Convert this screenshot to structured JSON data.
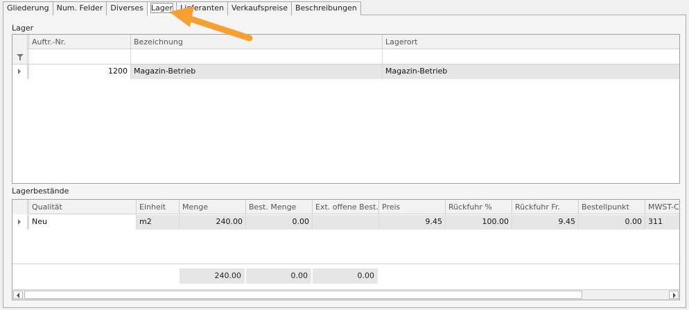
{
  "tabs": [
    "Gliederung",
    "Num. Felder",
    "Diverses",
    "Lager",
    "Lieferanten",
    "Verkaufspreise",
    "Beschreibungen"
  ],
  "active_tab": "Lager",
  "lager": {
    "title": "Lager",
    "columns": [
      "Auftr.-Nr.",
      "Bezeichnung",
      "Lagerort"
    ],
    "rows": [
      {
        "nr": "1200",
        "bezeichnung": "Magazin-Betrieb",
        "lagerort": "Magazin-Betrieb"
      }
    ]
  },
  "bestaende": {
    "title": "Lagerbestände",
    "columns": [
      "Qualität",
      "Einheit",
      "Menge",
      "Best. Menge",
      "Ext. offene Best...",
      "Preis",
      "Rückfuhr %",
      "Rückfuhr Fr.",
      "Bestellpunkt",
      "MWST-Co"
    ],
    "rows": [
      {
        "qualitaet": "Neu",
        "einheit": "m2",
        "menge": "240.00",
        "best_menge": "0.00",
        "ext_offene": "",
        "preis": "9.45",
        "rueckfuhr_pct": "100.00",
        "rueckfuhr_fr": "9.45",
        "bestellpunkt": "0.00",
        "mwst": "311"
      }
    ],
    "totals": {
      "menge": "240.00",
      "best_menge": "0.00",
      "ext_offene": "0.00"
    }
  },
  "colors": {
    "annotation_arrow": "#f5a030",
    "selected_row": "#e6e6e6"
  },
  "icons": [
    "filter-funnel-icon",
    "row-indicator-icon",
    "scroll-left-icon",
    "scroll-right-icon",
    "annotation-arrow-icon"
  ]
}
